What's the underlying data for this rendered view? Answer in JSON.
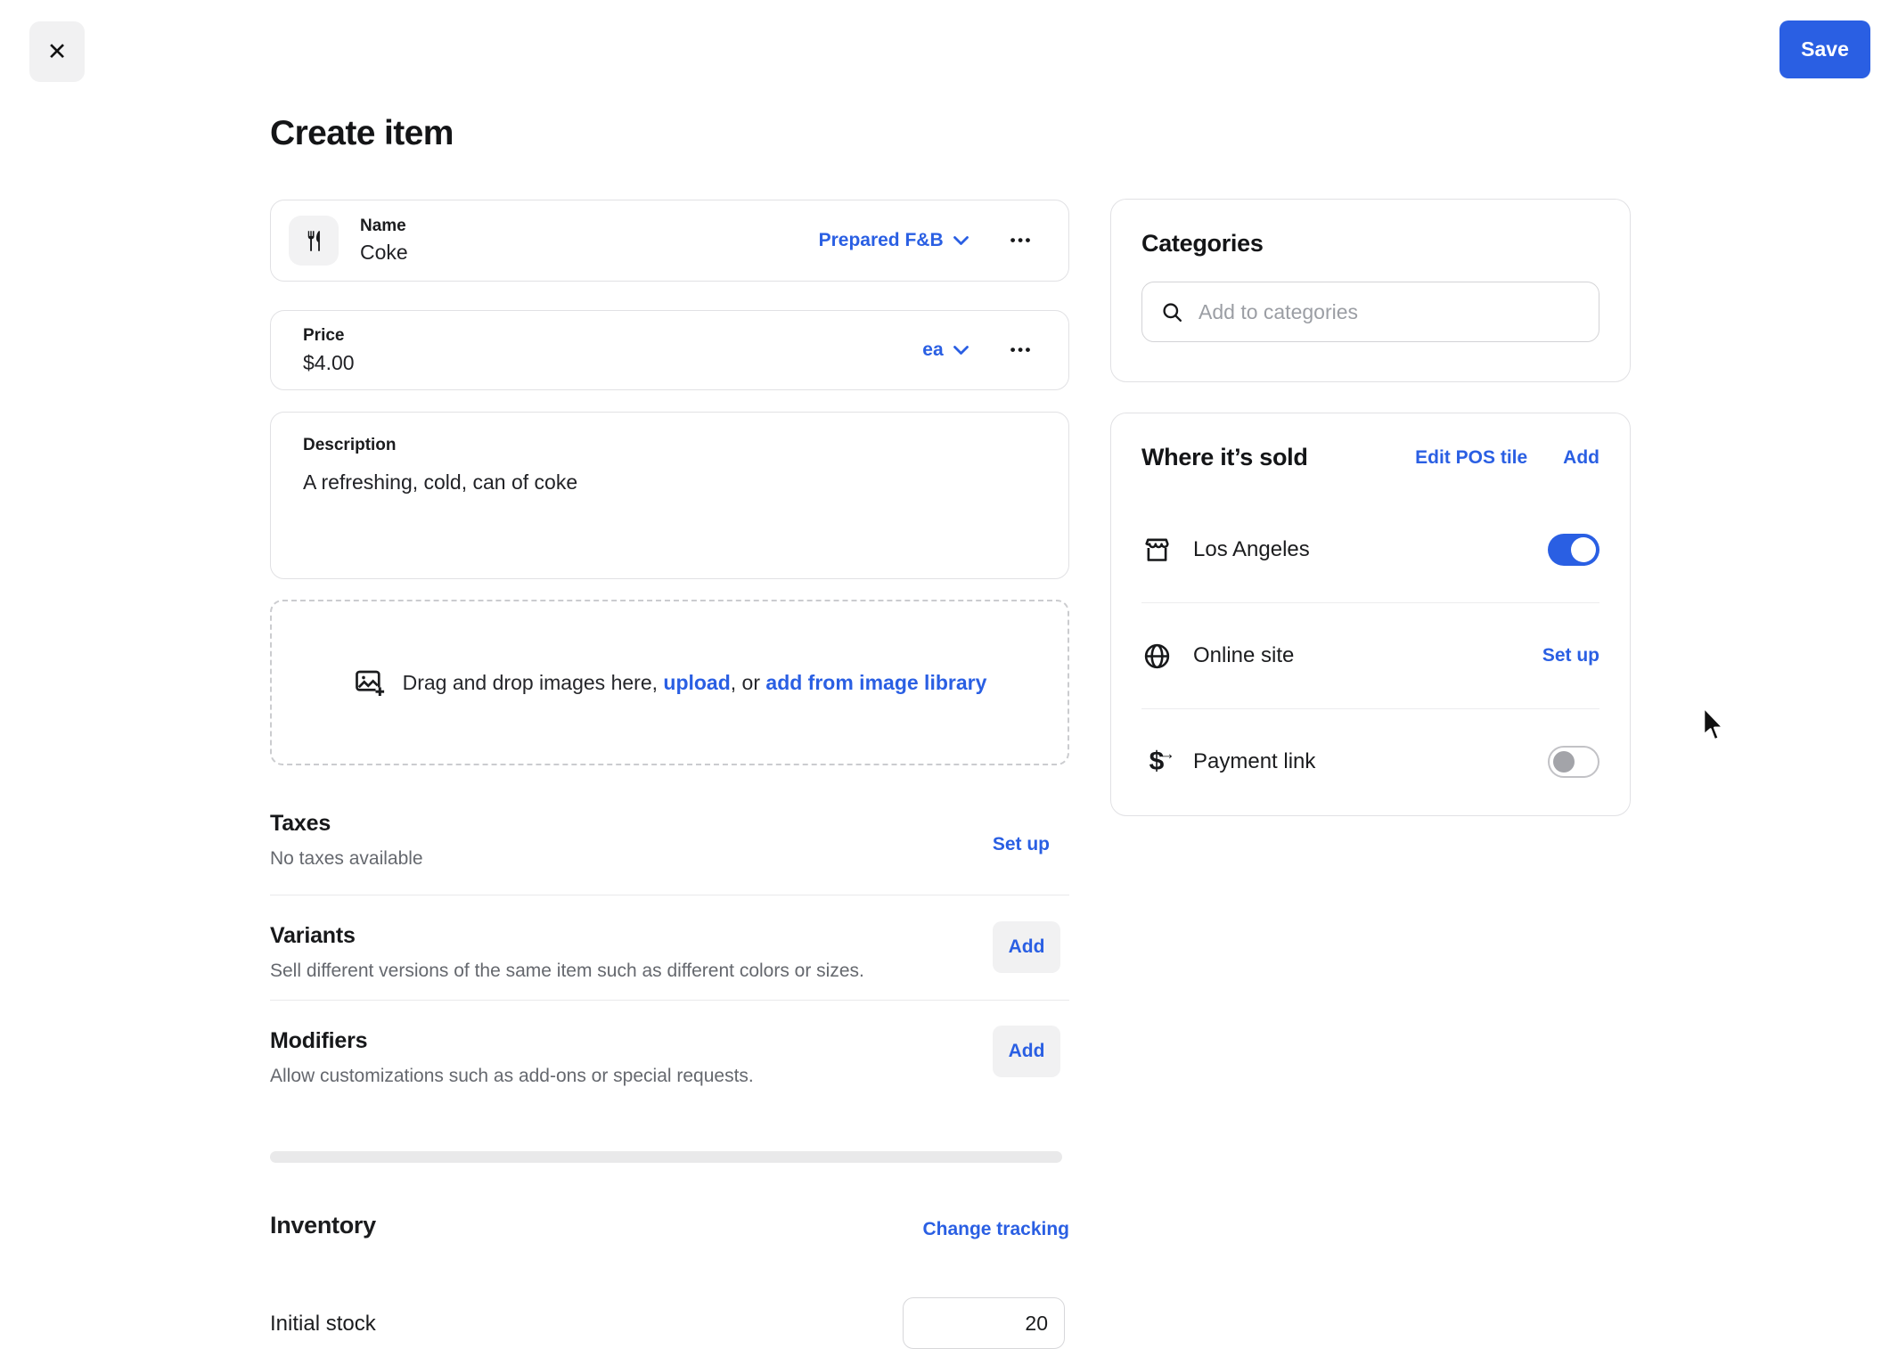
{
  "colors": {
    "accent": "#2a5fe3"
  },
  "icons": {
    "close": "✕",
    "ellipsis": "•••",
    "dollar": "$",
    "arrow_right": "→"
  },
  "header": {
    "save_label": "Save"
  },
  "page_title": "Create item",
  "item": {
    "name_label": "Name",
    "name_value": "Coke",
    "category_selector": "Prepared F&B",
    "price_label": "Price",
    "price_value": "$4.00",
    "unit_selector": "ea",
    "description_label": "Description",
    "description_value": "A refreshing, cold, can of coke"
  },
  "uploader": {
    "text_prefix": "Drag and drop images here, ",
    "upload_link": "upload",
    "text_middle": ", or ",
    "library_link": "add from image library"
  },
  "taxes": {
    "title": "Taxes",
    "subtitle": "No taxes available",
    "action": "Set up"
  },
  "variants": {
    "title": "Variants",
    "subtitle": "Sell different versions of the same item such as different colors or sizes.",
    "action": "Add"
  },
  "modifiers": {
    "title": "Modifiers",
    "subtitle": "Allow customizations such as add-ons or special requests.",
    "action": "Add"
  },
  "inventory": {
    "title": "Inventory",
    "action": "Change tracking",
    "stock_label": "Initial stock",
    "stock_value": "20"
  },
  "categories": {
    "title": "Categories",
    "placeholder": "Add to categories"
  },
  "where_sold": {
    "title": "Where it’s sold",
    "edit_pos_label": "Edit POS tile",
    "add_label": "Add",
    "rows": [
      {
        "label": "Los Angeles",
        "icon": "storefront-icon",
        "control": "toggle",
        "state": "on"
      },
      {
        "label": "Online site",
        "icon": "globe-icon",
        "control": "link",
        "action": "Set up"
      },
      {
        "label": "Payment link",
        "icon": "payment-link-icon",
        "control": "toggle",
        "state": "off"
      }
    ]
  }
}
